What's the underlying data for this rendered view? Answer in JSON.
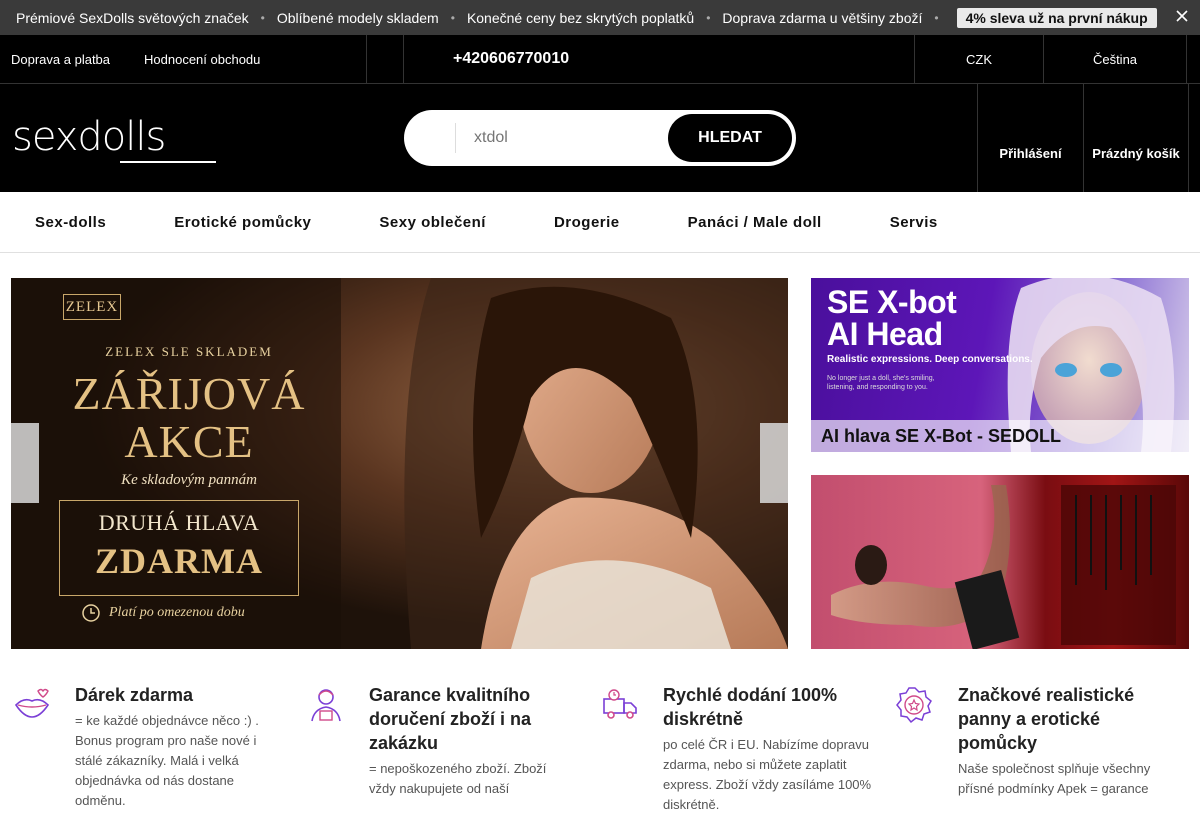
{
  "promo": {
    "items": [
      "Prémiové SexDolls světových značek",
      "Oblíbené modely skladem",
      "Konečné ceny bez skrytých poplatků",
      "Doprava zdarma u většiny zboží"
    ],
    "badge": "4% sleva už na první nákup"
  },
  "topbar": {
    "shipping": "Doprava a platba",
    "reviews": "Hodnocení obchodu",
    "phone": "+420606770010",
    "currency": "CZK",
    "language": "Čeština"
  },
  "header": {
    "logo": "sexdolls",
    "search_placeholder": "xtdol",
    "search_button": "HLEDAT",
    "login": "Přihlášení",
    "cart": "Prázdný košík"
  },
  "nav": [
    "Sex-dolls",
    "Erotické pomůcky",
    "Sexy oblečení",
    "Drogerie",
    "Panáci / Male doll",
    "Servis"
  ],
  "hero": {
    "brand": "ZELEX",
    "subtitle": "ZELEX SLE SKLADEM",
    "title_line1": "ZÁŘIJOVÁ",
    "title_line2": "AKCE",
    "tagline": "Ke skladovým pannám",
    "box_line1": "DRUHÁ HLAVA",
    "box_line2": "ZDARMA",
    "note": "Platí po omezenou dobu"
  },
  "banner1": {
    "title_line1": "SE X-bot",
    "title_line2": "AI Head",
    "tagline": "Realistic expressions. Deep conversations.",
    "small": "No longer just a doll, she's smiling, listening, and responding to you.",
    "caption": "AI hlava SE X-Bot - SEDOLL"
  },
  "features": [
    {
      "title": "Dárek zdarma",
      "desc": "= ke každé objednávce něco :) . Bonus program pro naše nové i stálé zákazníky. Malá i velká objednávka od nás dostane odměnu."
    },
    {
      "title": "Garance kvalitního doručení zboží i na zakázku",
      "desc": "= nepoškozeného zboží. Zboží vždy nakupujete od naší"
    },
    {
      "title": "Rychlé dodání 100% diskrétně",
      "desc": "po celé ČR i EU. Nabízíme dopravu zdarma, nebo si můžete zaplatit express. Zboží vždy zasíláme 100% diskrétně."
    },
    {
      "title": "Značkové realistické panny a erotické pomůcky",
      "desc": "Naše společnost splňuje všechny přísné podmínky Apek = garance"
    }
  ],
  "colors": {
    "black": "#000000",
    "promo_bg": "#3a3a3a",
    "banner_purple": "#5d16b8",
    "gold": "#e4c184"
  }
}
